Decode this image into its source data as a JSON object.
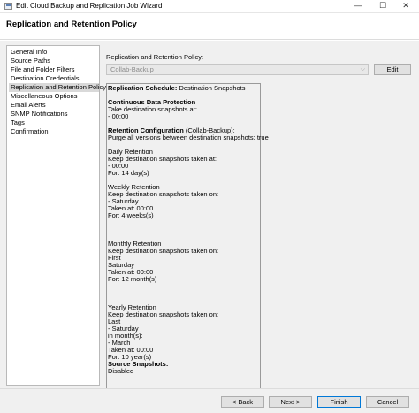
{
  "window": {
    "title": "Edit Cloud Backup and Replication Job Wizard",
    "minimize": "—",
    "maximize": "☐",
    "close": "✕"
  },
  "header": {
    "title": "Replication and Retention Policy"
  },
  "nav": {
    "items": [
      "General Info",
      "Source Paths",
      "File and Folder Filters",
      "Destination Credentials",
      "Replication and Retention Policy",
      "Miscellaneous Options",
      "Email Alerts",
      "SNMP Notifications",
      "Tags",
      "Confirmation"
    ],
    "selected_index": 4
  },
  "policy": {
    "label": "Replication and Retention Policy:",
    "selected": "Collab-Backup",
    "edit_label": "Edit",
    "dropdown_arrow": "⌵"
  },
  "details": {
    "schedule_label": "Replication Schedule:",
    "schedule_value": " Destination Snapshots",
    "cdp_heading": "Continuous Data Protection",
    "cdp_line1": "Take destination snapshots at:",
    "cdp_line2": " - 00:00",
    "retention_label": "Retention Configuration",
    "retention_value": " (Collab-Backup):",
    "purge_line": "Purge all versions between destination snapshots: true",
    "daily_heading": "Daily Retention",
    "daily_line1": "Keep destination snapshots taken at:",
    "daily_line2": " - 00:00",
    "daily_line3": "For: 14 day(s)",
    "weekly_heading": "Weekly Retention",
    "weekly_line1": "Keep destination snapshots taken on:",
    "weekly_line2": " - Saturday",
    "weekly_line3": "Taken at: 00:00",
    "weekly_line4": "For: 4 weeks(s)",
    "monthly_heading": "Monthly Retention",
    "monthly_line1": "Keep destination snapshots taken on:",
    "monthly_line2": "First",
    "monthly_line3": "Saturday",
    "monthly_line4": "Taken at: 00:00",
    "monthly_line5": "For: 12 month(s)",
    "yearly_heading": "Yearly Retention",
    "yearly_line1": "Keep destination snapshots taken on:",
    "yearly_line2": "Last",
    "yearly_line3": " - Saturday",
    "yearly_line4": "in month(s):",
    "yearly_line5": " - March",
    "yearly_line6": "Taken at: 00:00",
    "yearly_line7": "For: 10 year(s)",
    "source_heading": "Source Snapshots:",
    "source_value": "Disabled"
  },
  "footer": {
    "back": "< Back",
    "next": "Next >",
    "finish": "Finish",
    "cancel": "Cancel"
  }
}
